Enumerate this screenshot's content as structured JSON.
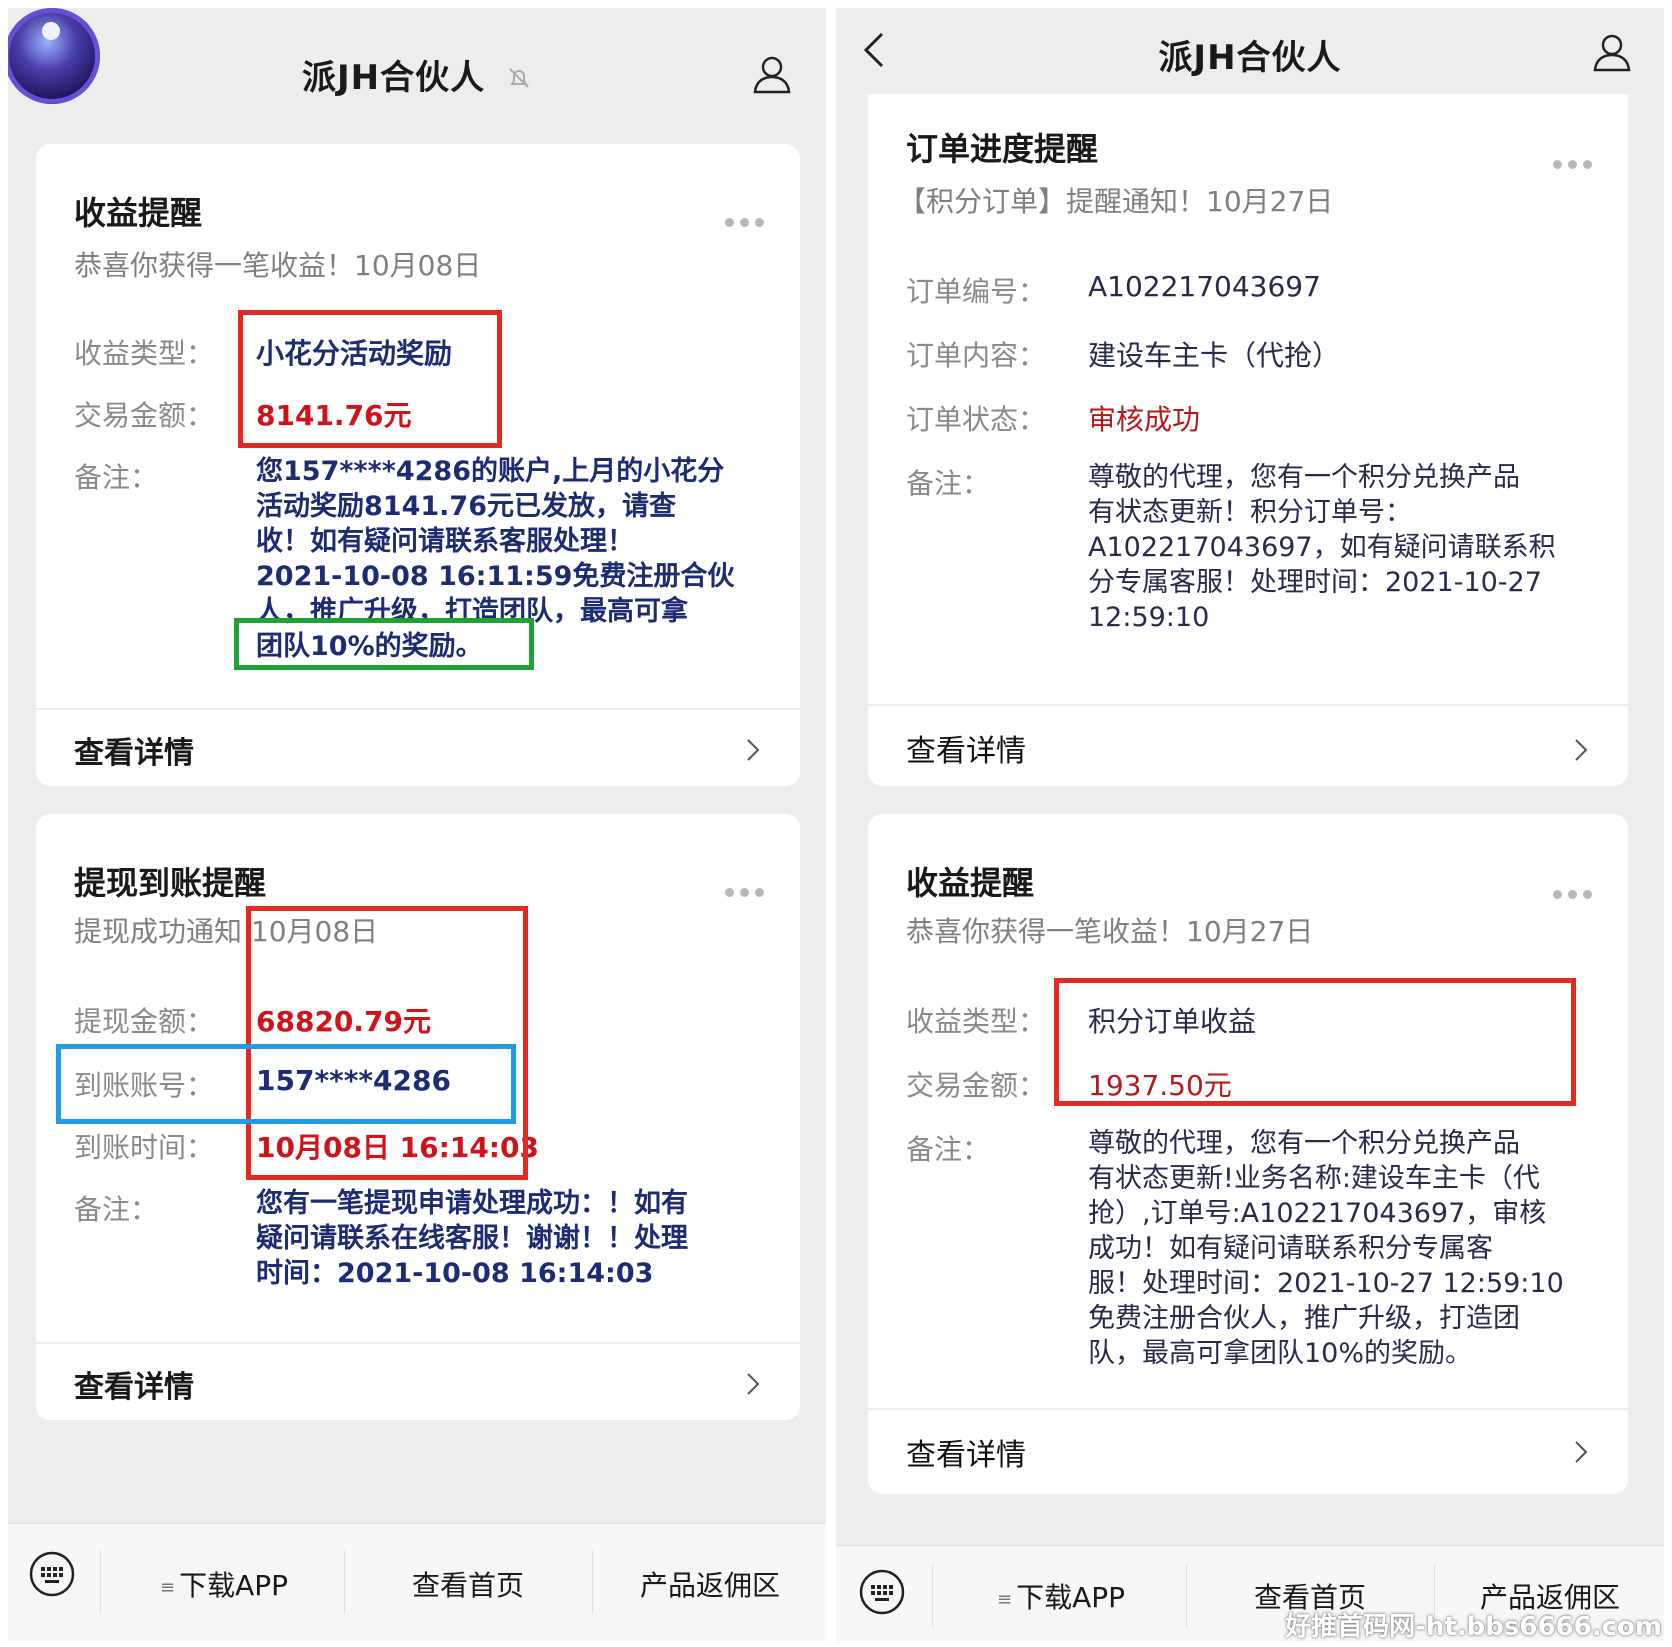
{
  "left": {
    "title": "派JH合伙人",
    "income_card": {
      "title": "收益提醒",
      "subtitle": "恭喜你获得一笔收益！10月08日",
      "type_label": "收益类型：",
      "type_value": "小花分活动奖励",
      "amount_label": "交易金额：",
      "amount_value": "8141.76元",
      "note_label": "备注：",
      "note_lines": [
        "您157****4286的账户,上月的小花分",
        "活动奖励8141.76元已发放，请查",
        "收！如有疑问请联系客服处理！",
        "2021-10-08 16:11:59免费注册合伙",
        "人，推广升级，打造团队，最高可拿",
        "团队10%的奖励。"
      ],
      "detail": "查看详情"
    },
    "withdraw_card": {
      "title": "提现到账提醒",
      "subtitle": "提现成功通知 10月08日",
      "amount_label": "提现金额：",
      "amount_value": "68820.79元",
      "account_label": "到账账号：",
      "account_value": "157****4286",
      "time_label": "到账时间：",
      "time_value": "10月08日 16:14:03",
      "note_label": "备注：",
      "note_lines": [
        "您有一笔提现申请处理成功：！如有",
        "疑问请联系在线客服！谢谢！！处理",
        "时间：2021-10-08 16:14:03"
      ],
      "detail": "查看详情"
    },
    "menu": [
      "下载APP",
      "查看首页",
      "产品返佣区"
    ]
  },
  "right": {
    "title": "派JH合伙人",
    "order_card": {
      "title": "订单进度提醒",
      "subtitle": "【积分订单】提醒通知！10月27日",
      "no_label": "订单编号：",
      "no_value": "A102217043697",
      "content_label": "订单内容：",
      "content_value": "建设车主卡（代抢）",
      "status_label": "订单状态：",
      "status_value": "审核成功",
      "note_label": "备注：",
      "note_lines": [
        "尊敬的代理，您有一个积分兑换产品",
        "有状态更新！积分订单号：",
        "A102217043697，如有疑问请联系积",
        "分专属客服！处理时间：2021-10-27",
        "12:59:10"
      ],
      "detail": "查看详情"
    },
    "income_card": {
      "title": "收益提醒",
      "subtitle": "恭喜你获得一笔收益！10月27日",
      "type_label": "收益类型：",
      "type_value": "积分订单收益",
      "amount_label": "交易金额：",
      "amount_value": "1937.50元",
      "note_label": "备注：",
      "note_lines": [
        "尊敬的代理，您有一个积分兑换产品",
        "有状态更新!业务名称:建设车主卡（代",
        "抢）,订单号:A102217043697，审核",
        "成功！如有疑问请联系积分专属客",
        "服！处理时间：2021-10-27 12:59:10",
        "免费注册合伙人，推广升级，打造团",
        "队，最高可拿团队10%的奖励。"
      ],
      "detail": "查看详情"
    },
    "menu": [
      "下载APP",
      "查看首页",
      "产品返佣区"
    ]
  },
  "watermark": "好推首码网-ht.bbs6666.com",
  "colors": {
    "highlight_red": "#e22a22",
    "highlight_green": "#1fa336",
    "highlight_blue": "#1e9ce8",
    "value_blue": "#1d2d73",
    "value_red": "#d0121b"
  }
}
